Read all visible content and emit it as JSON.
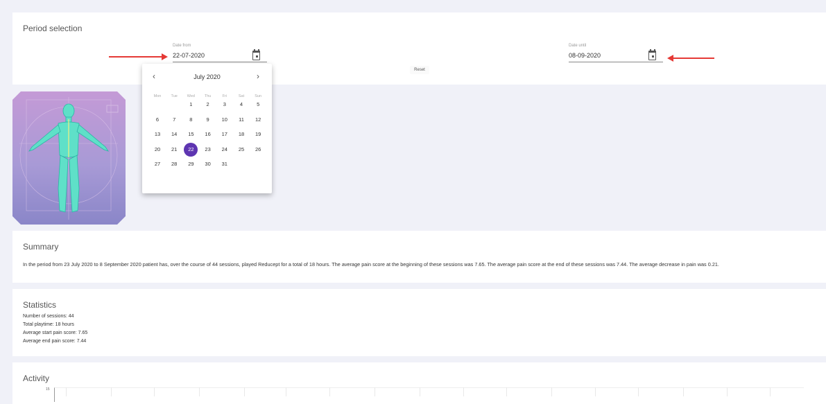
{
  "period": {
    "title": "Period selection",
    "date_from": {
      "label": "Date from",
      "value": "22-07-2020"
    },
    "date_until": {
      "label": "Date until",
      "value": "08-09-2020"
    },
    "reset_label": "Reset",
    "annotation_color": "#e53935"
  },
  "datepicker": {
    "month_label": "July 2020",
    "prev_icon": "chevron-left-icon",
    "next_icon": "chevron-right-icon",
    "weekdays": [
      "Mon",
      "Tue",
      "Wed",
      "Thu",
      "Fri",
      "Sat",
      "Sun"
    ],
    "weeks": [
      [
        "",
        "",
        "1",
        "2",
        "3",
        "4",
        "5"
      ],
      [
        "6",
        "7",
        "8",
        "9",
        "10",
        "11",
        "12"
      ],
      [
        "13",
        "14",
        "15",
        "16",
        "17",
        "18",
        "19"
      ],
      [
        "20",
        "21",
        "22",
        "23",
        "24",
        "25",
        "26"
      ],
      [
        "27",
        "28",
        "29",
        "30",
        "31",
        "",
        ""
      ]
    ],
    "selected_day": "22",
    "accent_color": "#5e35b1"
  },
  "summary": {
    "title": "Summary",
    "text": "In the period from 23 July 2020 to 8 September 2020 patient has, over the course of 44 sessions, played Reducept for a total of 18 hours. The average pain score at the beginning of these sessions was 7.65. The average pain score at the end of these sessions was 7.44. The average decrease in pain was 0.21."
  },
  "statistics": {
    "title": "Statistics",
    "lines": [
      "Number of sessions: 44",
      "Total playtime: 18 hours",
      "Average start pain score: 7.65",
      "Average end pain score: 7.44"
    ]
  },
  "activity": {
    "title": "Activity",
    "y_top_tick": "15"
  }
}
